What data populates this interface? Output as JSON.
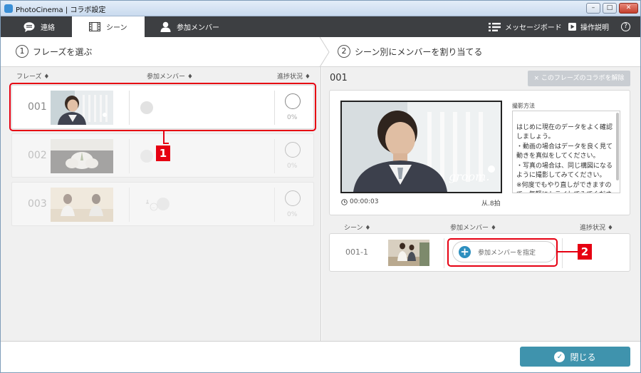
{
  "window": {
    "title": "PhotoCinema | コラボ設定",
    "minimize": "–",
    "maximize": "□",
    "close": "✕"
  },
  "nav": {
    "tabs": [
      {
        "label": "連絡",
        "icon": "chat-bubble-icon"
      },
      {
        "label": "シーン",
        "icon": "film-strip-icon"
      },
      {
        "label": "参加メンバー",
        "icon": "person-icon"
      }
    ],
    "active_tab": "シーン",
    "message_board": "メッセージボード",
    "help": "操作説明",
    "info": "?"
  },
  "steps": {
    "step1_num": "1",
    "step1_label": "フレーズを選ぶ",
    "step2_num": "2",
    "step2_label": "シーン別にメンバーを割り当てる"
  },
  "phrase_list": {
    "col_phrase": "フレーズ ♦",
    "col_members": "参加メンバー ♦",
    "col_progress": "進捗状況 ♦",
    "rows": [
      {
        "num": "001",
        "progress": "0%",
        "selected": true
      },
      {
        "num": "002",
        "progress": "0%",
        "selected": false
      },
      {
        "num": "003",
        "progress": "0%",
        "selected": false
      }
    ]
  },
  "annotations": {
    "badge1": "1",
    "badge2": "2"
  },
  "detail": {
    "phrase_title": "001",
    "unlink_button": "× このフレーズのコラボを解除",
    "time": "00:00:03",
    "beats": "从.8拍",
    "method_label": "撮影方法",
    "method_text": "はじめに現在のデータをよく確認しましょう。\n・動画の場合はデータを良く見て動きを真似をしてください。\n・写真の場合は、同じ構図になるように撮影してみてください。\n※何度でもやり直しができますので、気軽にトライしてみてください。",
    "preview_overlay": "groom."
  },
  "scenes": {
    "col_scene": "シーン ♦",
    "col_members": "参加メンバー ♦",
    "col_progress": "進捗状況 ♦",
    "row_id": "001-1",
    "assign_button": "参加メンバーを指定"
  },
  "footer": {
    "close_button": "閉じる"
  },
  "colors": {
    "nav_bg": "#3d3f42",
    "accent": "#3f93ad",
    "annotation_red": "#e60012"
  }
}
